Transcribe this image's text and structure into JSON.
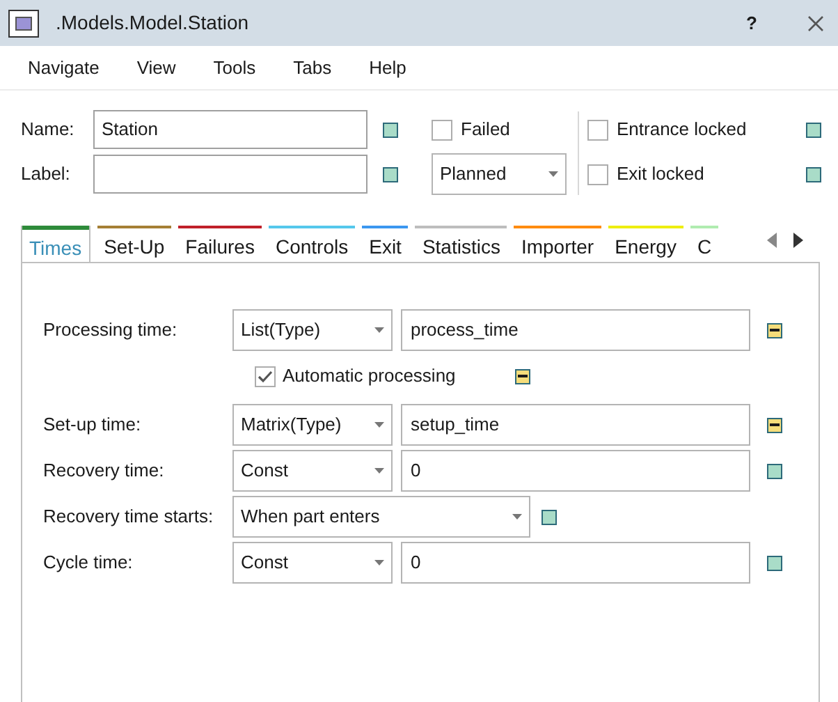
{
  "window": {
    "title": ".Models.Model.Station",
    "help": "?"
  },
  "menu": [
    "Navigate",
    "View",
    "Tools",
    "Tabs",
    "Help"
  ],
  "general": {
    "fields": [
      {
        "label": "Name:",
        "value": "Station",
        "inherited": false
      },
      {
        "label": "Label:",
        "inherited": false
      }
    ],
    "failed": {
      "label": "Failed",
      "checked": false
    },
    "failure_mode": {
      "value": "Planned"
    },
    "locks": [
      {
        "label": "Entrance locked",
        "checked": false,
        "inherited": false
      },
      {
        "label": "Exit locked",
        "checked": false,
        "inherited": false
      }
    ]
  },
  "tabs": [
    {
      "label": "Times",
      "color": "#2e8b3a",
      "selected": true
    },
    {
      "label": "Set-Up",
      "color": "#a57f35",
      "selected": false
    },
    {
      "label": "Failures",
      "color": "#c0202a",
      "selected": false
    },
    {
      "label": "Controls",
      "color": "#55c8ec",
      "selected": false
    },
    {
      "label": "Exit",
      "color": "#3b97f0",
      "selected": false
    },
    {
      "label": "Statistics",
      "color": "#bdbdbd",
      "selected": false
    },
    {
      "label": "Importer",
      "color": "#ff8c10",
      "selected": false
    },
    {
      "label": "Energy",
      "color": "#eeee10",
      "selected": false
    },
    {
      "label": "C",
      "color": "#b0ecb0",
      "selected": false
    }
  ],
  "times": [
    {
      "kind": "formula",
      "label": "Processing time:",
      "type": "List(Type)",
      "value": "process_time",
      "inherited": true
    },
    {
      "kind": "checkbox",
      "label": "Automatic processing",
      "checked": true,
      "inherited": true
    },
    {
      "kind": "formula",
      "label": "Set-up time:",
      "type": "Matrix(Type)",
      "value": "setup_time",
      "inherited": true
    },
    {
      "kind": "formula",
      "label": "Recovery time:",
      "type": "Const",
      "value": "0",
      "inherited": false
    },
    {
      "kind": "select",
      "label": "Recovery time starts:",
      "value": "When part enters",
      "inherited": false
    },
    {
      "kind": "formula",
      "label": "Cycle time:",
      "type": "Const",
      "value": "0",
      "inherited": false
    }
  ]
}
